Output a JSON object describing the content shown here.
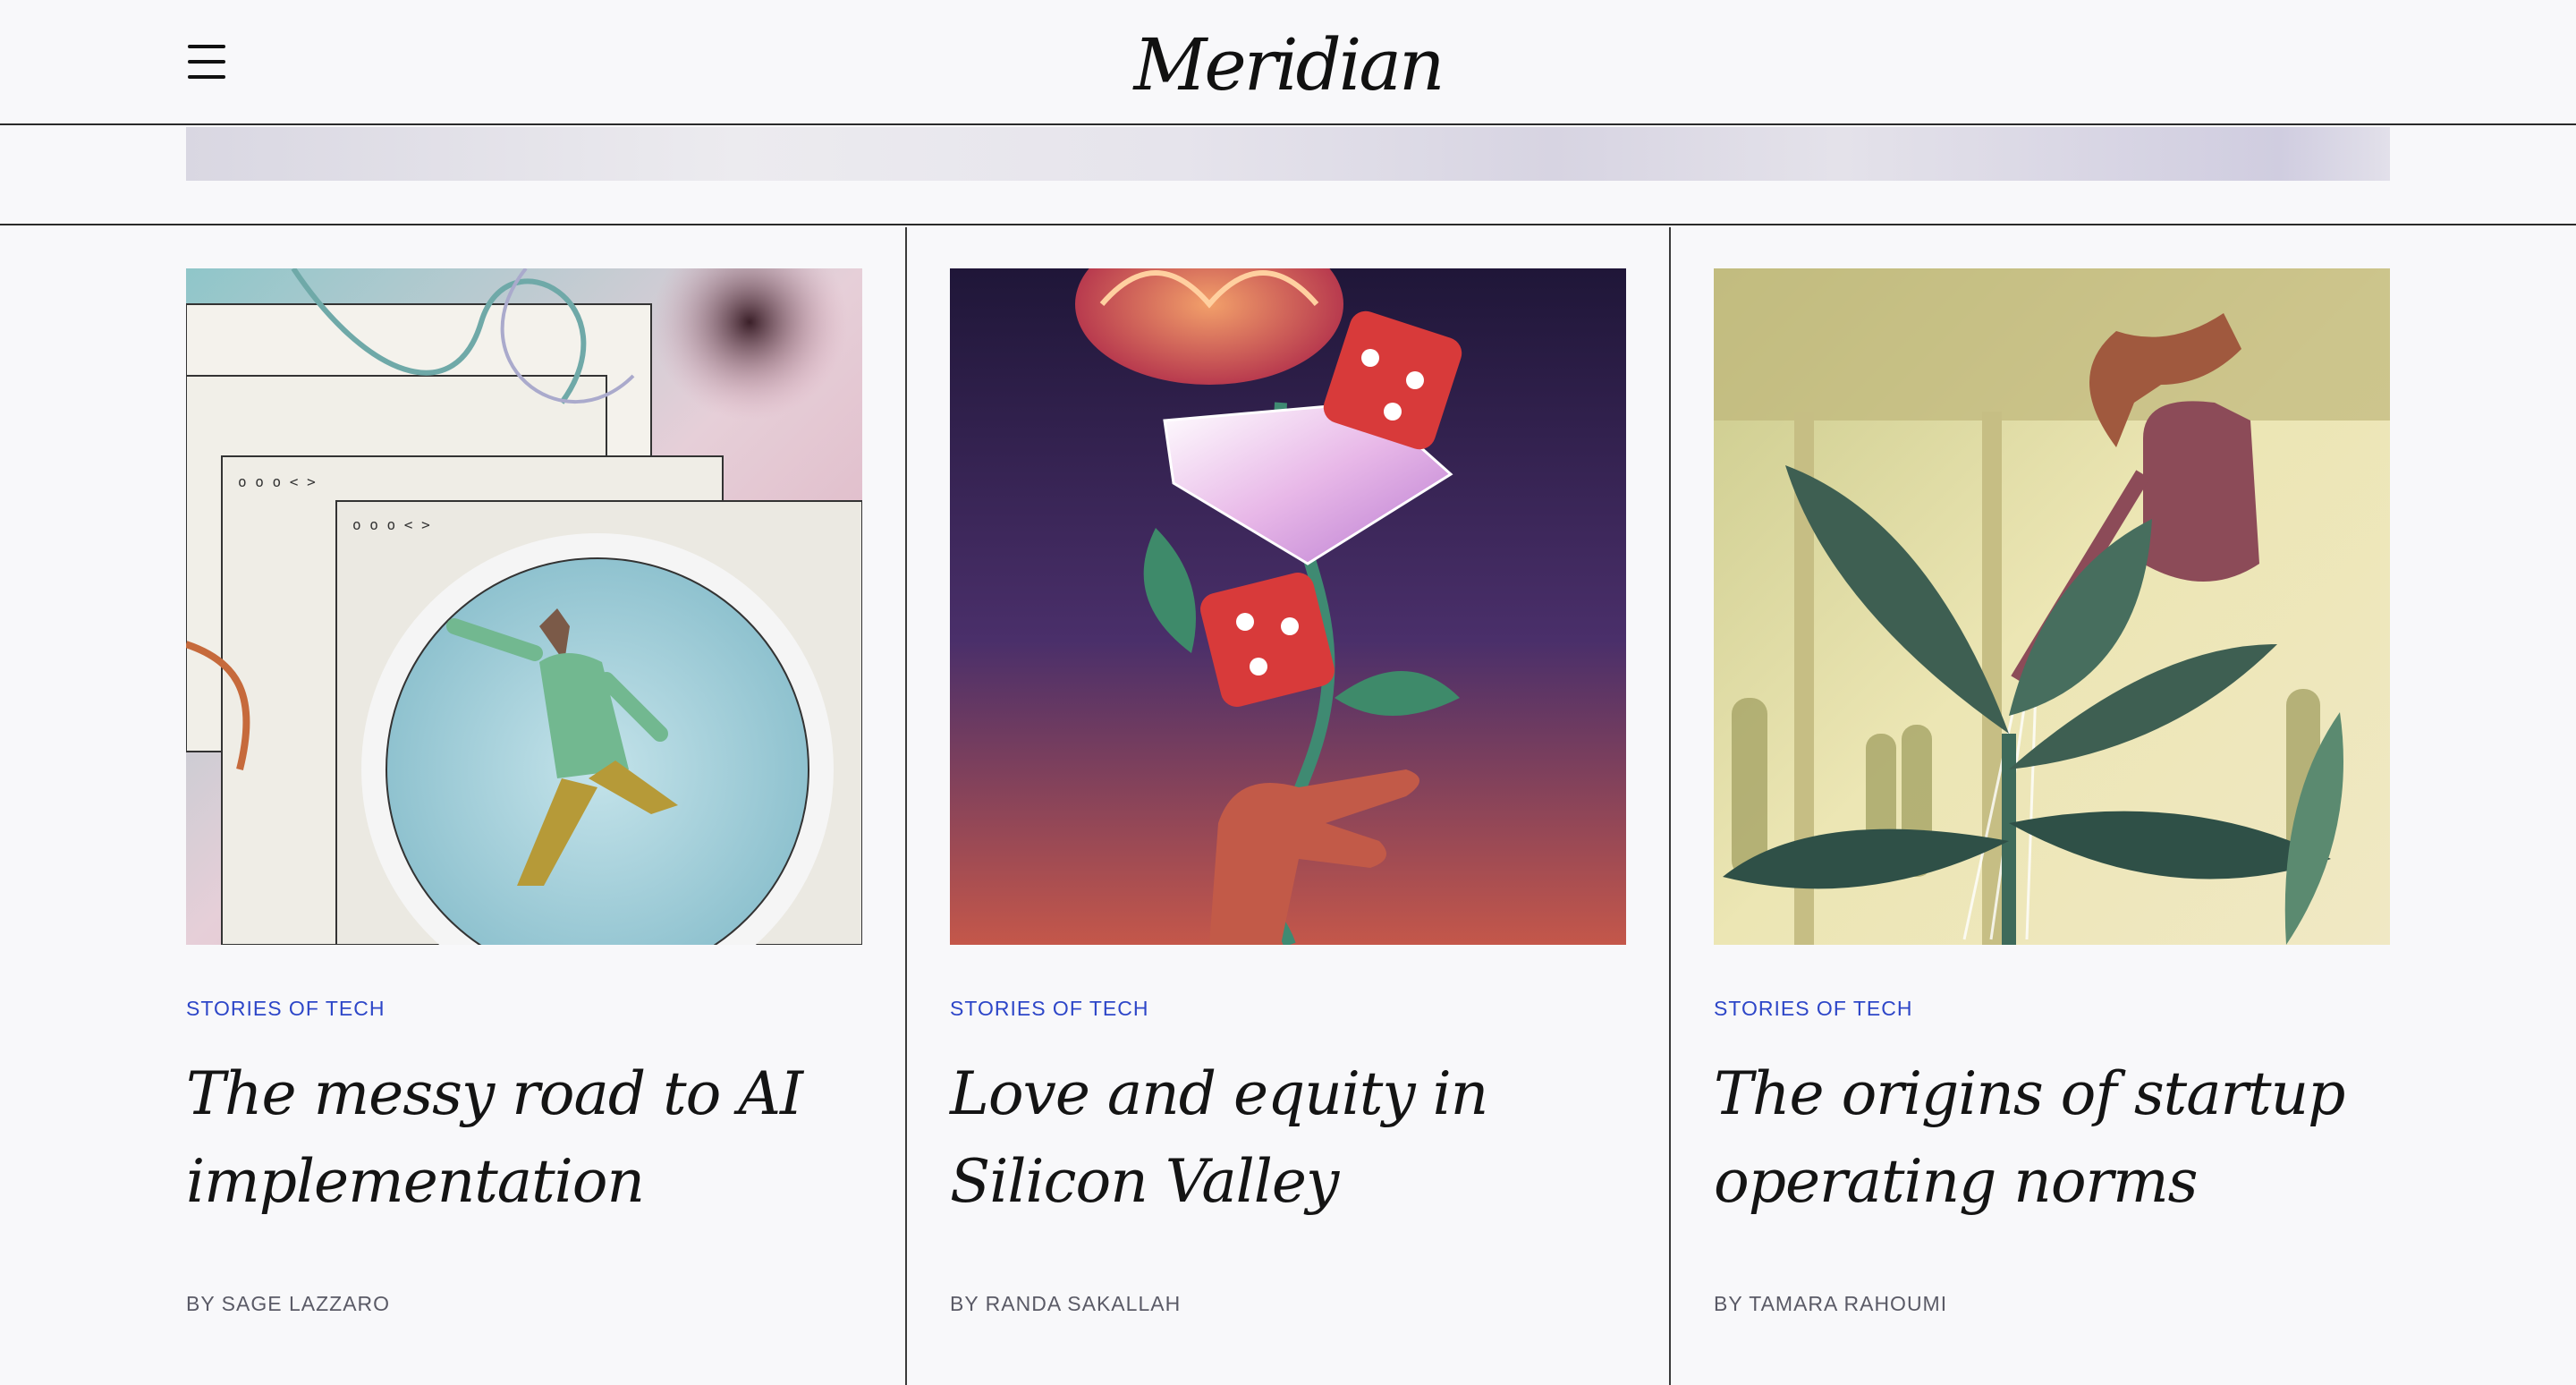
{
  "header": {
    "logo": "Meridian",
    "menu_icon": "hamburger-menu-icon"
  },
  "articles": [
    {
      "category": "STORIES OF TECH",
      "title": "The messy road to AI implementation",
      "byline": "BY SAGE LAZZARO",
      "image": "illustration-man-running-in-hamster-wheel"
    },
    {
      "category": "STORIES OF TECH",
      "title": "Love and equity in Silicon Valley",
      "byline": "BY RANDA SAKALLAH",
      "image": "illustration-hand-holding-rose-diamond-dice"
    },
    {
      "category": "STORIES OF TECH",
      "title": "The origins of startup operating norms",
      "byline": "BY TAMARA RAHOUMI",
      "image": "illustration-hand-watering-plant"
    }
  ]
}
